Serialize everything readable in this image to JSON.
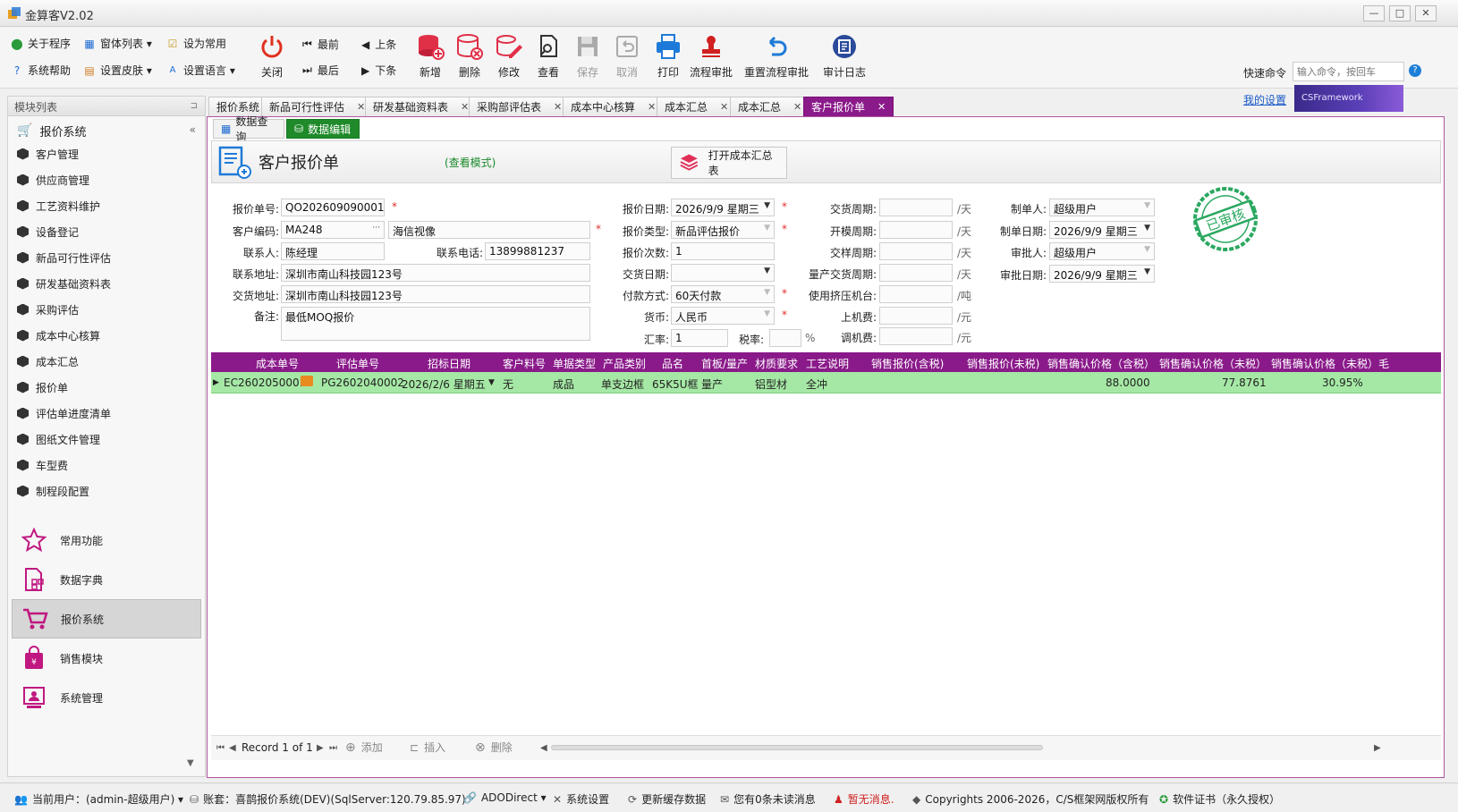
{
  "window": {
    "title": "金算客V2.02"
  },
  "toolbar": {
    "small": [
      [
        "关于程序",
        "窗体列表 ▾",
        "设为常用"
      ],
      [
        "系统帮助",
        "设置皮肤 ▾",
        "设置语言 ▾"
      ]
    ],
    "close_label": "关闭",
    "nav": {
      "first": "最前",
      "prev": "上条",
      "last": "最后",
      "next": "下条"
    },
    "buttons": {
      "add": "新增",
      "delete": "删除",
      "edit": "修改",
      "view": "查看",
      "save": "保存",
      "cancel": "取消",
      "print": "打印",
      "flow_approve": "流程审批",
      "reset_flow": "重置流程审批",
      "audit_log": "审计日志"
    },
    "quick_label": "快速命令",
    "quick_placeholder": "输入命令，按回车",
    "my_settings": "我的设置",
    "brand": "CSFramework"
  },
  "left_panel": {
    "header": "模块列表",
    "section": "报价系统",
    "items": [
      "客户管理",
      "供应商管理",
      "工艺资料维护",
      "设备登记",
      "新品可行性评估",
      "研发基础资料表",
      "采购评估",
      "成本中心核算",
      "成本汇总",
      "报价单",
      "评估单进度清单",
      "图纸文件管理",
      "车型费",
      "制程段配置"
    ],
    "modules": [
      "常用功能",
      "数据字典",
      "报价系统",
      "销售模块",
      "系统管理"
    ]
  },
  "tabs": [
    "报价系统",
    "新品可行性评估",
    "研发基础资料表",
    "采购部评估表",
    "成本中心核算",
    "成本汇总",
    "成本汇总",
    "客户报价单"
  ],
  "subtabs": [
    "数据查询",
    "数据编辑"
  ],
  "form": {
    "title": "客户报价单",
    "mode": "(查看模式)",
    "open_cost_btn": "打开成本汇总表",
    "labels": {
      "quote_no": "报价单号:",
      "cust_code": "客户编码:",
      "contact": "联系人:",
      "phone": "联系电话:",
      "contact_addr": "联系地址:",
      "delivery_addr": "交货地址:",
      "remark": "备注:",
      "quote_date": "报价日期:",
      "quote_type": "报价类型:",
      "quote_count": "报价次数:",
      "delivery_date": "交货日期:",
      "payment": "付款方式:",
      "currency": "货币:",
      "rate": "汇率:",
      "tax": "税率:",
      "delivery_cycle": "交货周期:",
      "mold_cycle": "开模周期:",
      "sample_cycle": "交样周期:",
      "mass_cycle": "量产交货周期:",
      "extruder": "使用挤压机台:",
      "machine_fee": "上机费:",
      "adjust_fee": "调机费:",
      "maker": "制单人:",
      "make_date": "制单日期:",
      "approver": "审批人:",
      "approve_date": "审批日期:"
    },
    "values": {
      "quote_no": "QO202609090001",
      "cust_code": "MA248",
      "cust_name": "海信视像",
      "contact": "陈经理",
      "phone": "13899881237",
      "contact_addr": "深圳市南山科技园123号",
      "delivery_addr": "深圳市南山科技园123号",
      "remark": "最低MOQ报价",
      "quote_date": "2026/9/9 星期三",
      "quote_type": "新品评估报价",
      "quote_count": "1",
      "delivery_date": "",
      "payment": "60天付款",
      "currency": "人民币",
      "rate": "1",
      "tax": "",
      "maker": "超级用户",
      "make_date": "2026/9/9 星期三",
      "approver": "超级用户",
      "approve_date": "2026/9/9 星期三"
    },
    "units": {
      "day": "/天",
      "ton": "/吨",
      "yuan": "/元",
      "percent": "%"
    },
    "required_mark": "*",
    "stamp": "已审核"
  },
  "grid": {
    "columns": [
      "成本单号",
      "评估单号",
      "招标日期",
      "客户料号",
      "单据类型",
      "产品类别",
      "品名",
      "首板/量产",
      "材质要求",
      "工艺说明",
      "销售报价(含税)",
      "销售报价(未税)",
      "销售确认价格（含税）",
      "销售确认价格（未税）",
      "销售确认价格（未税）毛"
    ],
    "rows": [
      [
        "EC2602050001",
        "PG2602040002",
        "2026/2/6 星期五",
        "无",
        "成品",
        "单支边框",
        "65K5U框",
        "量产",
        "铝型材",
        "全冲",
        "",
        "",
        "88.0000",
        "77.8761",
        "30.95%"
      ]
    ],
    "record_info": "Record 1 of 1",
    "nav_add": "添加",
    "nav_insert": "插入",
    "nav_delete": "删除"
  },
  "statusbar": {
    "user": "当前用户：(admin-超级用户) ▾",
    "account": "账套：喜鹊报价系统(DEV)(SqlServer:120.79.85.97)",
    "ado": "ADODirect ▾",
    "settings": "系统设置",
    "refresh": "更新缓存数据",
    "messages": "您有0条未读消息",
    "no_msg": "暂无消息.",
    "copyright": "Copyrights 2006-2026，C/S框架网版权所有",
    "license": "软件证书（永久授权）"
  }
}
